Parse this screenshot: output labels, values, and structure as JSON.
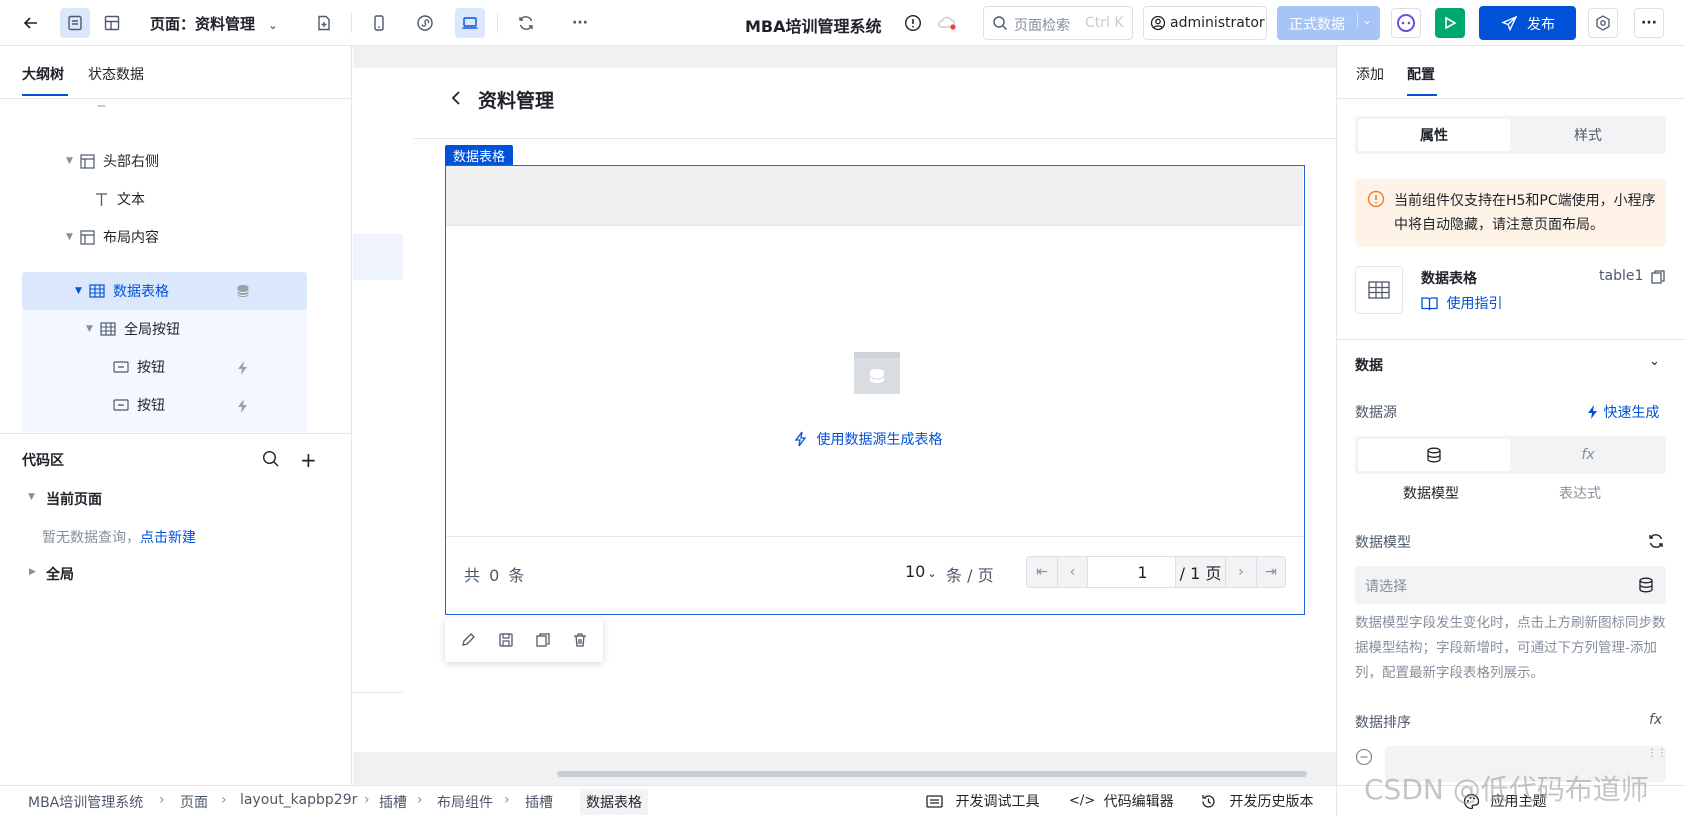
{
  "topbar": {
    "page_label": "页面：资料管理",
    "app_title": "MBA培训管理系统",
    "search_placeholder": "页面检索",
    "search_shortcut": "Ctrl K",
    "user": "administrator",
    "env_label": "正式数据",
    "publish_label": "发布"
  },
  "left": {
    "tabs": [
      "大纲树",
      "状态数据"
    ],
    "tree": [
      {
        "label": "头部右侧",
        "icon": "layout-icon"
      },
      {
        "label": "文本",
        "icon": "text-icon"
      },
      {
        "label": "布局内容",
        "icon": "layout-icon"
      },
      {
        "label": "数据表格",
        "icon": "table-icon"
      },
      {
        "label": "全局按钮",
        "icon": "table-icon"
      },
      {
        "label": "按钮",
        "icon": "button-icon"
      },
      {
        "label": "按钮",
        "icon": "button-icon"
      }
    ],
    "code_title": "代码区",
    "current_page": "当前页面",
    "empty_hint": "暂无数据查询，",
    "create_link": "点击新建",
    "global": "全局"
  },
  "canvas": {
    "page_title": "资料管理",
    "component_tag": "数据表格",
    "generate_link": "使用数据源生成表格",
    "total_prefix": "共",
    "total_count": "0",
    "total_suffix": "条",
    "page_size": "10",
    "per_page": "条 / 页",
    "current_page": "1",
    "total_pages": "/ 1 页"
  },
  "right": {
    "tabs": [
      "添加",
      "配置"
    ],
    "seg_tabs": [
      "属性",
      "样式"
    ],
    "notice": "当前组件仅支持在H5和PC端使用，小程序中将自动隐藏，请注意页面布局。",
    "component_name": "数据表格",
    "component_id": "table1",
    "guide_link": "使用指引",
    "section_data": "数据",
    "datasource_label": "数据源",
    "quick_gen": "快速生成",
    "src_model": "数据模型",
    "src_expr": "表达式",
    "model_label": "数据模型",
    "model_placeholder": "请选择",
    "model_help": "数据模型字段发生变化时，点击上方刷新图标同步数据模型结构；字段新增时，可通过下方列管理-添加列，配置最新字段表格列展示。",
    "sort_label": "数据排序"
  },
  "bottom": {
    "breadcrumb": [
      "MBA培训管理系统",
      "页面",
      "layout_kapbp29r",
      "插槽",
      "布局组件",
      "插槽",
      "数据表格"
    ],
    "debug_tool": "开发调试工具",
    "code_editor": "代码编辑器",
    "history": "开发历史版本",
    "theme": "应用主题",
    "watermark": "CSDN @低代码布道师"
  },
  "colors": {
    "primary": "#0052d9",
    "selected_bg": "#dbe7fb",
    "notice_bg": "#fff3e8",
    "run_green": "#00a870"
  }
}
